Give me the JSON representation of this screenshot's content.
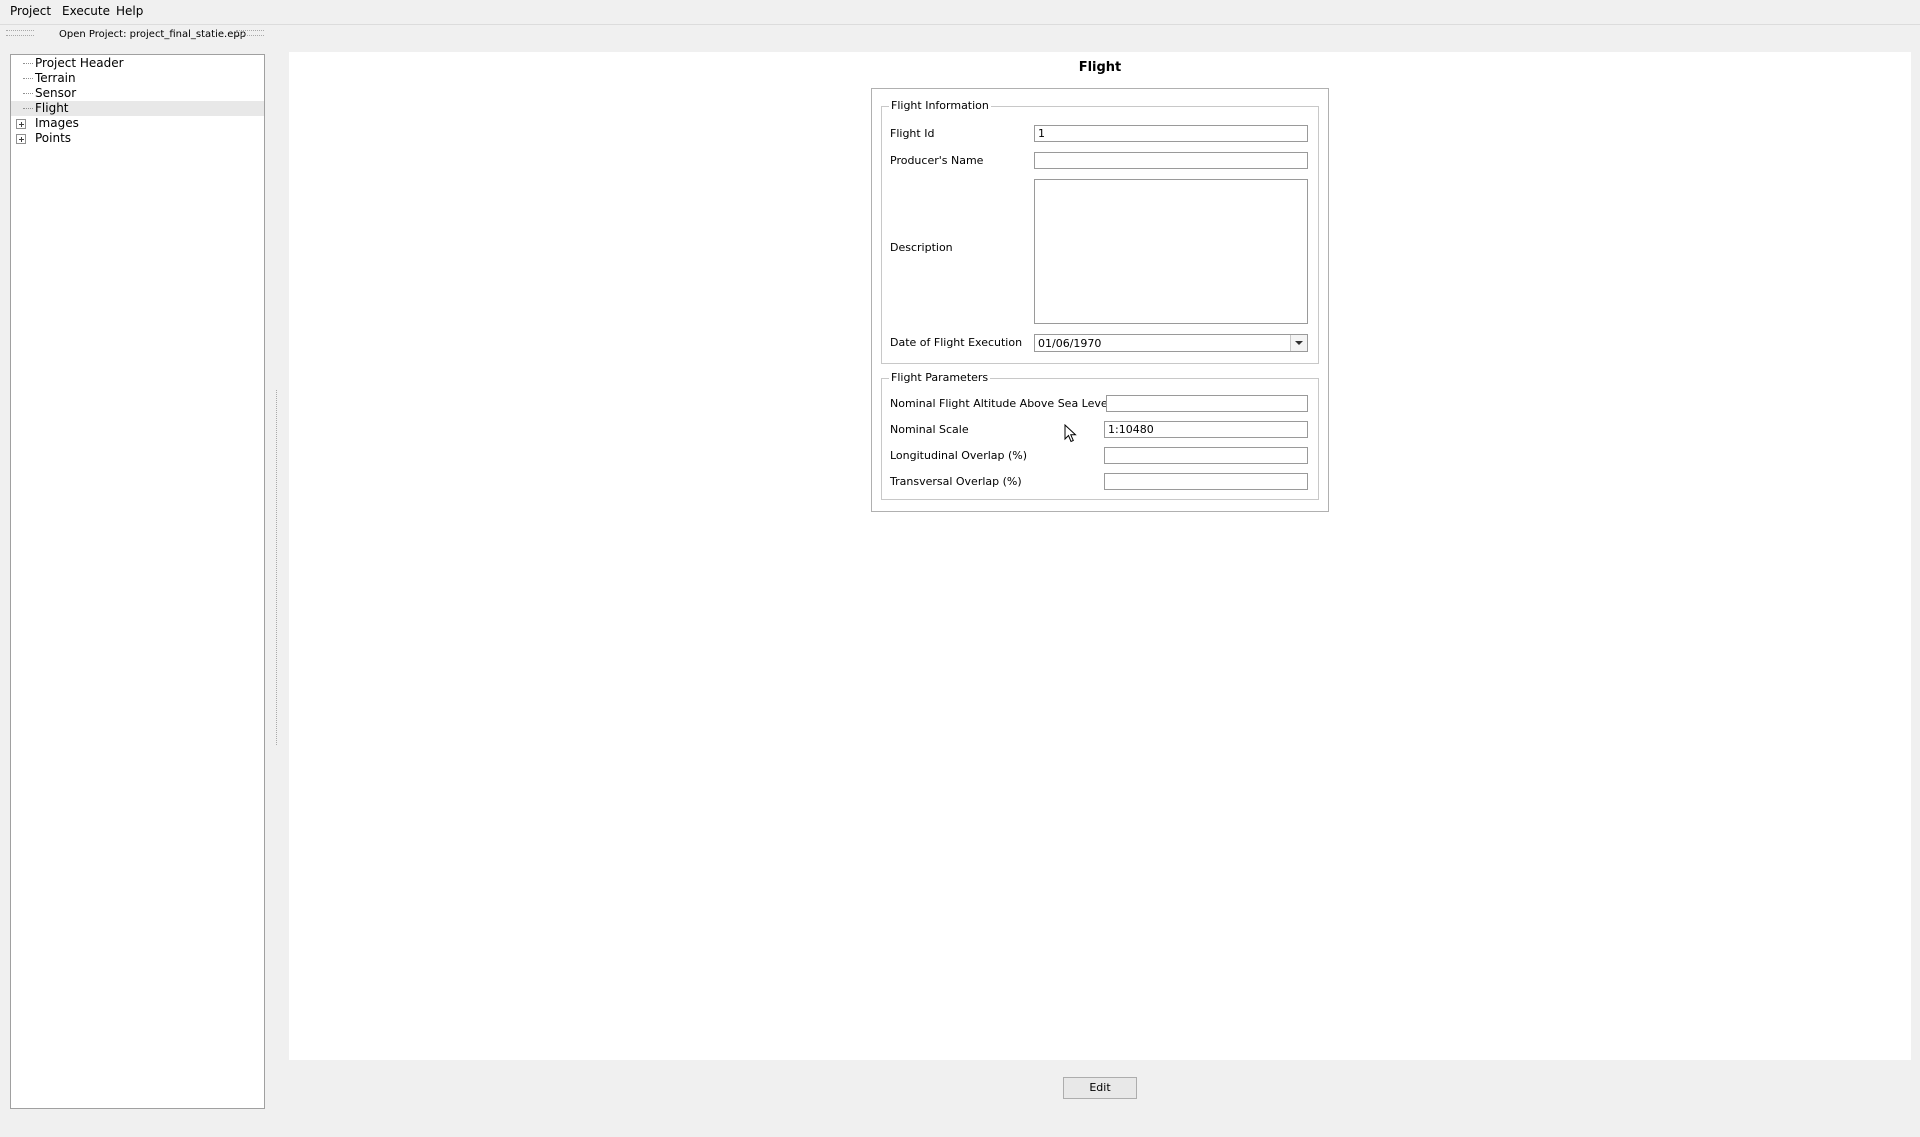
{
  "menu": {
    "project": "Project",
    "execute": "Execute",
    "help": "Help"
  },
  "toolbar": {
    "open_project": "Open Project: project_final_statie.epp"
  },
  "tree": {
    "items": [
      {
        "label": "Project Header"
      },
      {
        "label": "Terrain"
      },
      {
        "label": "Sensor"
      },
      {
        "label": "Flight"
      },
      {
        "label": "Images"
      },
      {
        "label": "Points"
      }
    ]
  },
  "page": {
    "title": "Flight"
  },
  "flight_information": {
    "group_title": "Flight Information",
    "flight_id_label": "Flight Id",
    "flight_id_value": "1",
    "producer_label": "Producer's Name",
    "producer_value": "",
    "description_label": "Description",
    "description_value": "",
    "date_label": "Date of Flight Execution",
    "date_value": "01/06/1970"
  },
  "flight_parameters": {
    "group_title": "Flight Parameters",
    "altitude_label": "Nominal Flight Altitude Above Sea Level (m)",
    "altitude_value": "",
    "scale_label": "Nominal Scale",
    "scale_value": "1:10480",
    "longitudinal_label": "Longitudinal Overlap (%)",
    "longitudinal_value": "",
    "transversal_label": "Transversal Overlap (%)",
    "transversal_value": ""
  },
  "actions": {
    "edit_label": "Edit"
  },
  "icons": {
    "expander": "plus-box-icon",
    "dropdown": "chevron-down-icon",
    "cursor": "mouse-pointer-icon"
  }
}
